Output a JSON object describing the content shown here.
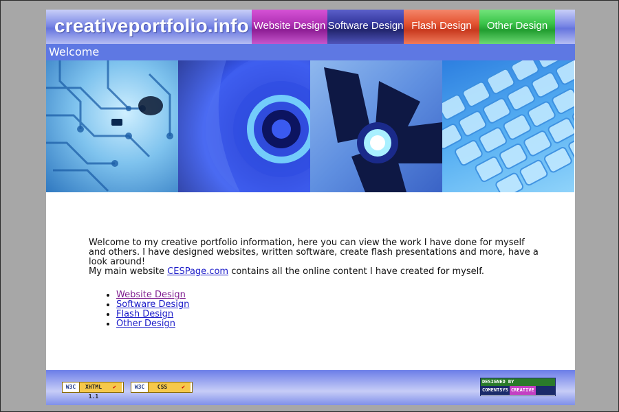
{
  "header": {
    "site_title": "creativeportfolio.info",
    "nav": [
      {
        "label": "Website Design"
      },
      {
        "label": "Software Design"
      },
      {
        "label": "Flash Design"
      },
      {
        "label": "Other Design"
      }
    ]
  },
  "page_heading": "Welcome",
  "content": {
    "intro": "Welcome to my creative portfolio information, here you can view the work I have done for myself and others. I have designed websites, written software, create flash presentations and more, have a look around!",
    "main_site_prefix": "My main website ",
    "main_site_link": "CESPage.com",
    "main_site_suffix": " contains all the online content I have created for myself.",
    "links": [
      {
        "label": "Website Design"
      },
      {
        "label": "Software Design"
      },
      {
        "label": "Flash Design"
      },
      {
        "label": "Other Design"
      }
    ]
  },
  "footer": {
    "xhtml_badge": {
      "w3c": "W3C",
      "text": "XHTML 1.1",
      "check": "✔"
    },
    "css_badge": {
      "w3c": "W3C",
      "text": "CSS",
      "check": "✔"
    },
    "designed_by": {
      "top": "DESIGNED BY",
      "left": "COMENTSYS",
      "right": "CREATIVE"
    }
  },
  "colors": {
    "nav_website": "#b233b6",
    "nav_software": "#35389e",
    "nav_flash": "#e45432",
    "nav_other": "#3bc44a",
    "welcome_bar": "#5e78e3",
    "link": "#1a1ac8",
    "visited_link": "#7d1a8e"
  }
}
